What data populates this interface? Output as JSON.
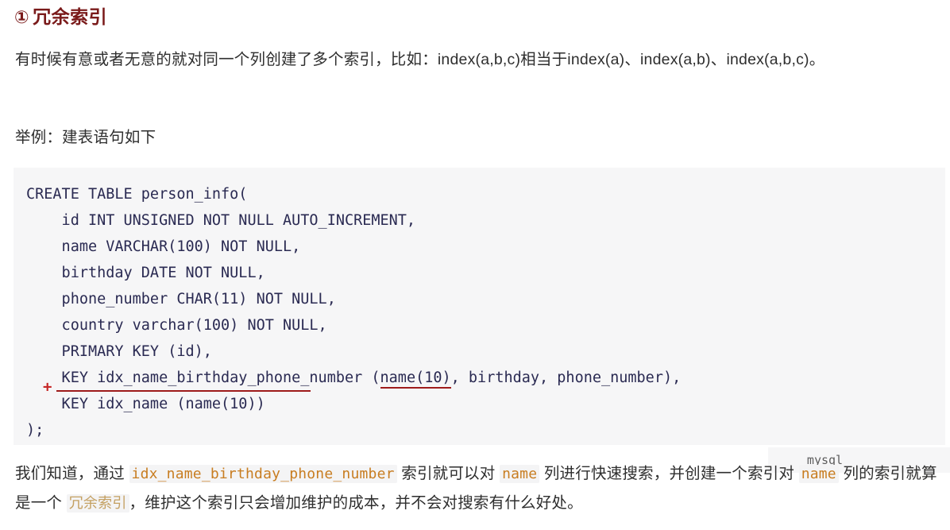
{
  "heading": {
    "marker": "①",
    "text": "冗余索引"
  },
  "paragraphs": {
    "intro": "有时候有意或者无意的就对同一个列创建了多个索引，比如：index(a,b,c)相当于index(a)、index(a,b)、index(a,b,c)。",
    "example": "举例：建表语句如下"
  },
  "code_block": {
    "language_label": "mysql",
    "lines": [
      "CREATE TABLE person_info(",
      "    id INT UNSIGNED NOT NULL AUTO_INCREMENT,",
      "    name VARCHAR(100) NOT NULL,",
      "    birthday DATE NOT NULL,",
      "    phone_number CHAR(11) NOT NULL,",
      "    country varchar(100) NOT NULL,",
      "    PRIMARY KEY (id),",
      "    KEY idx_name_birthday_phone_number (name(10), birthday, phone_number),",
      "    KEY idx_name (name(10))",
      ");"
    ],
    "underlined_token": "name(10)",
    "annotations": {
      "plus_mark": "+",
      "struck_line": "    KEY idx_name (name(10))"
    }
  },
  "conclusion": {
    "part1": "我们知道，通过 ",
    "code1": "idx_name_birthday_phone_number",
    "part2": " 索引就可以对 ",
    "code2": "name",
    "part3": " 列进行快速搜索，并创建一个索引",
    "part4": "对 ",
    "code3": "name",
    "part5": " 列的索引就算是一个 ",
    "code4": "冗余索引",
    "part6": "，维护这个索引只会增加维护的成本，并不会对搜索有什么好处。"
  },
  "colors": {
    "heading": "#7a1a1a",
    "code_text": "#2a2a52",
    "code_background": "#f6f6f7",
    "annotation_red": "#9e1b1b",
    "plus_red": "#c62828",
    "inline_code": "#c87d21",
    "inline_code_muted": "#c4a062",
    "body_text": "#2e2e2e"
  }
}
